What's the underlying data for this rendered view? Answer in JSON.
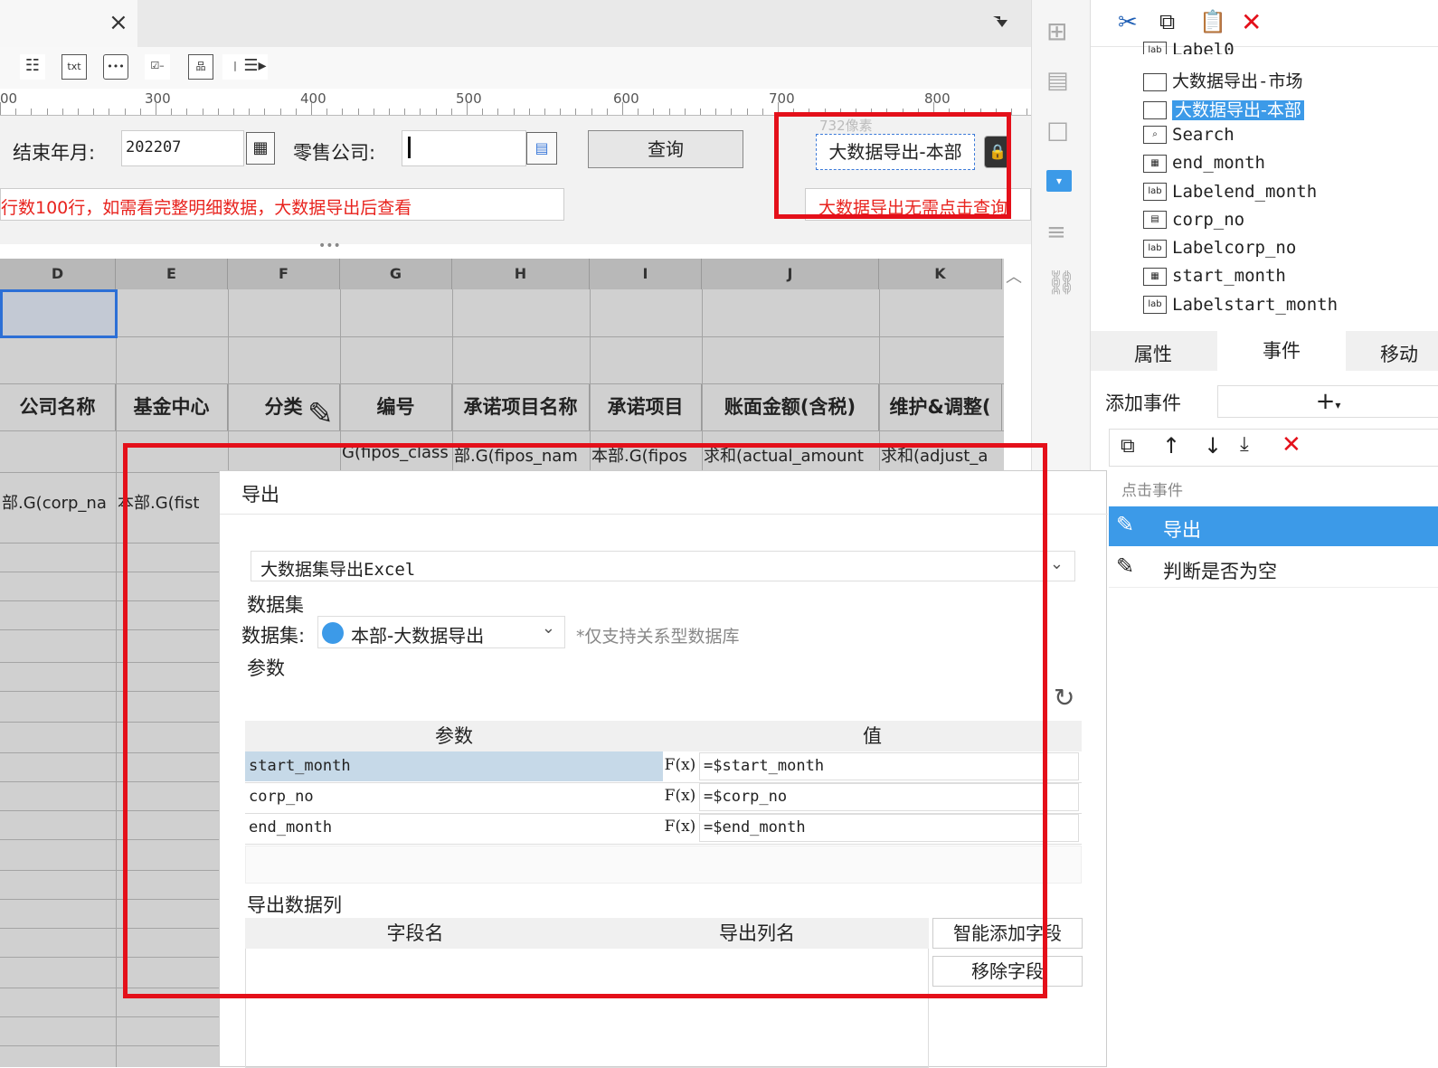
{
  "tabbar": {
    "close_icon": "close-icon",
    "menu_icon": "dropdown-menu-icon"
  },
  "ruler": {
    "labels": [
      "00",
      "300",
      "400",
      "500",
      "600",
      "700",
      "800"
    ]
  },
  "form": {
    "end_month_label": "结束年月:",
    "end_month_value": "202207",
    "corp_label": "零售公司:",
    "corp_value": "",
    "query_button": "查询",
    "notice": "行数100行，如需看完整明细数据，大数据导出后查看",
    "export_button": "大数据导出-本部",
    "size_hint": "732像素",
    "export_notice": "大数据导出无需点击查询"
  },
  "grid": {
    "columns": [
      "D",
      "E",
      "F",
      "G",
      "H",
      "I",
      "J",
      "K"
    ],
    "headers": [
      "公司名称",
      "基金中心",
      "分类",
      "编号",
      "承诺项目名称",
      "承诺项目",
      "账面金额(含税)",
      "维护&调整("
    ],
    "formula_row": [
      "",
      "",
      "",
      "G(fipos_class",
      "部.G(fipos_nam",
      "本部.G(fipos",
      "求和(actual_amount",
      "求和(adjust_a"
    ],
    "data_row": [
      "部.G(corp_na",
      "本部.G(fist",
      "",
      "",
      "",
      "",
      "",
      ""
    ]
  },
  "tree": {
    "items": [
      {
        "icon": "label-icon",
        "label": "Label0"
      },
      {
        "icon": "button-icon",
        "label": "大数据导出-市场"
      },
      {
        "icon": "button-icon",
        "label": "大数据导出-本部",
        "selected": true
      },
      {
        "icon": "search-icon",
        "label": "Search"
      },
      {
        "icon": "date-icon",
        "label": "end_month"
      },
      {
        "icon": "label-icon",
        "label": "Labelend_month"
      },
      {
        "icon": "combo-icon",
        "label": "corp_no"
      },
      {
        "icon": "label-icon",
        "label": "Labelcorp_no"
      },
      {
        "icon": "date-icon",
        "label": "start_month"
      },
      {
        "icon": "label-icon",
        "label": "Labelstart_month"
      }
    ]
  },
  "right_tabs": [
    "属性",
    "事件",
    "移动"
  ],
  "events": {
    "add_label": "添加事件",
    "section": "点击事件",
    "items": [
      {
        "label": "导出",
        "selected": true
      },
      {
        "label": "判断是否为空",
        "selected": false
      }
    ]
  },
  "dialog": {
    "title": "导出",
    "action_type": "大数据集导出Excel",
    "dataset_section": "数据集",
    "dataset_label": "数据集:",
    "dataset_value": "本部-大数据导出",
    "dataset_note": "*仅支持关系型数据库",
    "param_section": "参数",
    "param_header": "参数",
    "value_header": "值",
    "params": [
      {
        "name": "start_month",
        "fx": "F(x)",
        "value": "=$start_month"
      },
      {
        "name": "corp_no",
        "fx": "F(x)",
        "value": "=$corp_no"
      },
      {
        "name": "end_month",
        "fx": "F(x)",
        "value": "=$end_month"
      }
    ],
    "export_cols_section": "导出数据列",
    "field_header": "字段名",
    "export_col_header": "导出列名",
    "smart_add_button": "智能添加字段",
    "remove_button": "移除字段"
  },
  "colors": {
    "highlight_red": "#e4101a",
    "selection_blue": "#3c9ae8",
    "notice_red": "#e8231e"
  }
}
